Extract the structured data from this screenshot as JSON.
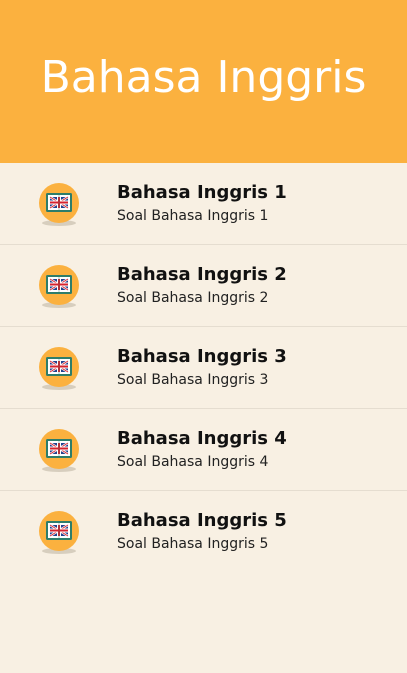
{
  "app": {
    "title": "Bahasa Inggris"
  },
  "colors": {
    "header_bg": "#fbb13f",
    "list_bg": "#f8f0e3",
    "icon_circle": "#fbb13f",
    "divider": "#e5ddd0"
  },
  "items": [
    {
      "title": "Bahasa Inggris 1",
      "subtitle": "Soal Bahasa Inggris 1",
      "icon": "uk-book-icon"
    },
    {
      "title": "Bahasa Inggris 2",
      "subtitle": "Soal Bahasa Inggris 2",
      "icon": "uk-book-icon"
    },
    {
      "title": "Bahasa Inggris 3",
      "subtitle": "Soal Bahasa Inggris 3",
      "icon": "uk-book-icon"
    },
    {
      "title": "Bahasa Inggris 4",
      "subtitle": "Soal Bahasa Inggris 4",
      "icon": "uk-book-icon"
    },
    {
      "title": "Bahasa Inggris 5",
      "subtitle": "Soal Bahasa Inggris 5",
      "icon": "uk-book-icon"
    }
  ]
}
